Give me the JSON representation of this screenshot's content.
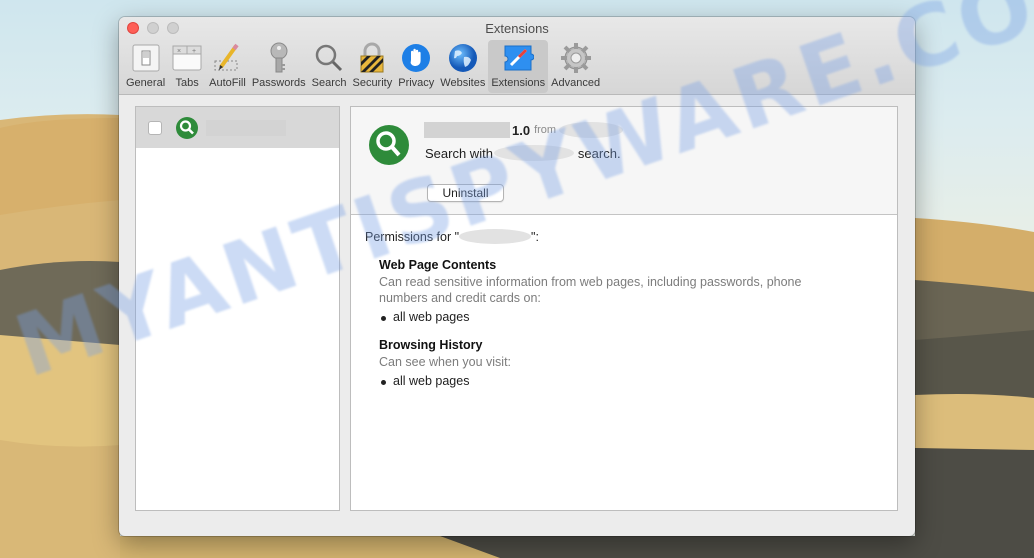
{
  "window": {
    "title": "Extensions",
    "traffic_lights": [
      "close",
      "minimize",
      "zoom"
    ]
  },
  "toolbar": {
    "active": "Extensions",
    "tabs": [
      {
        "label": "General",
        "icon": "general-switch-icon"
      },
      {
        "label": "Tabs",
        "icon": "tabs-icon"
      },
      {
        "label": "AutoFill",
        "icon": "pencil-icon"
      },
      {
        "label": "Passwords",
        "icon": "key-icon"
      },
      {
        "label": "Search",
        "icon": "magnifier-icon"
      },
      {
        "label": "Security",
        "icon": "padlock-icon"
      },
      {
        "label": "Privacy",
        "icon": "hand-icon"
      },
      {
        "label": "Websites",
        "icon": "globe-icon"
      },
      {
        "label": "Extensions",
        "icon": "puzzle-compass-icon"
      },
      {
        "label": "Advanced",
        "icon": "gear-icon"
      }
    ]
  },
  "sidebar": {
    "items": [
      {
        "name": "",
        "enabled": false,
        "icon": "green-search-icon",
        "selected": true
      }
    ]
  },
  "detail": {
    "name": "",
    "version": "1.0",
    "from_label": "from",
    "developer": "",
    "description_prefix": "Search with",
    "description_suffix": "search.",
    "uninstall_label": "Uninstall",
    "permissions_prefix": "Permissions for \"",
    "permissions_suffix": "\":",
    "permissions": [
      {
        "title": "Web Page Contents",
        "description": "Can read sensitive information from web pages, including passwords, phone numbers and credit cards on:",
        "items": [
          "all web pages"
        ]
      },
      {
        "title": "Browsing History",
        "description": "Can see when you visit:",
        "items": [
          "all web pages"
        ]
      }
    ]
  },
  "watermark": "MYANTISPYWARE.COM",
  "colors": {
    "accent_green": "#2e8b3a",
    "close_red": "#fe5f57",
    "active_tab_bg": "#c9c9c9"
  }
}
